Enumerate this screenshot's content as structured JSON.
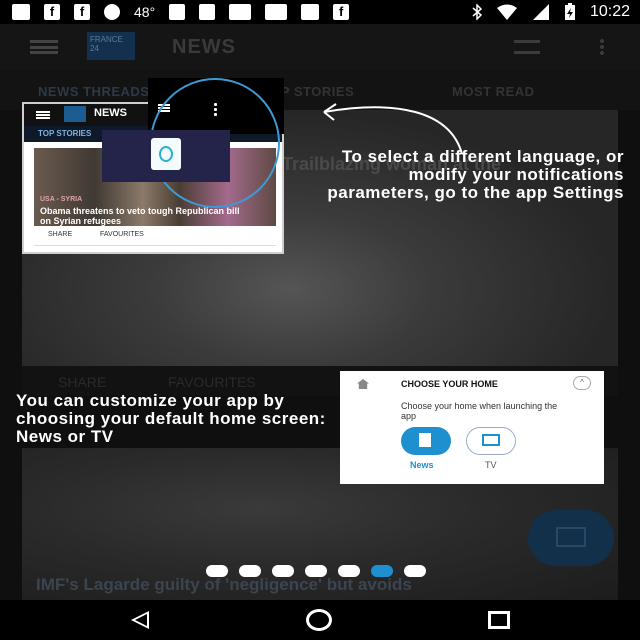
{
  "status_bar": {
    "temperature": "48°",
    "time": "10:22",
    "fb_glyph": "f"
  },
  "app": {
    "toolbar_title": "NEWS",
    "logo_text": "FRANCE 24",
    "tabs": [
      "NEWS THREADS",
      "TOP STORIES",
      "MOST READ"
    ],
    "card_1": {
      "headline": "Trailblazing woman at the",
      "share_label": "SHARE",
      "favourites_label": "FAVOURITES"
    },
    "card_2": {
      "headline": "IMF's Lagarde guilty of 'negligence' but avoids"
    }
  },
  "overlay": {
    "mini": {
      "title": "NEWS",
      "tab": "TOP STORIES",
      "kicker": "USA - SYRIA",
      "headline": "Obama threatens to veto tough Republican bill on Syrian refugees",
      "share_label": "SHARE",
      "favourites_label": "FAVOURITES"
    },
    "settings_text": "To select a different language, or modify your notifications parameters, go to the app Settings",
    "home_text": "You can customize your app by choosing your default home screen: News or TV",
    "home_box": {
      "title": "CHOOSE YOUR HOME",
      "subtitle": "Choose your home when launching the app",
      "news_label": "News",
      "tv_label": "TV",
      "collapse_glyph": "^"
    },
    "pager": {
      "total": 7,
      "active_index": 5
    }
  },
  "colors": {
    "accent": "#1e90d0",
    "highlight_ring": "#3c9ad6",
    "overlay_text": "#ffffff"
  },
  "icons": {
    "status": [
      "message-icon",
      "facebook-icon",
      "facebook-icon",
      "weather-icon",
      "sport-icon",
      "wrench-icon",
      "game-icon",
      "game-icon",
      "fox-icon",
      "facebook-icon",
      "bluetooth-icon",
      "wifi-icon",
      "signal-icon",
      "battery-icon"
    ],
    "nav": [
      "back-icon",
      "home-icon",
      "recent-apps-icon"
    ]
  }
}
